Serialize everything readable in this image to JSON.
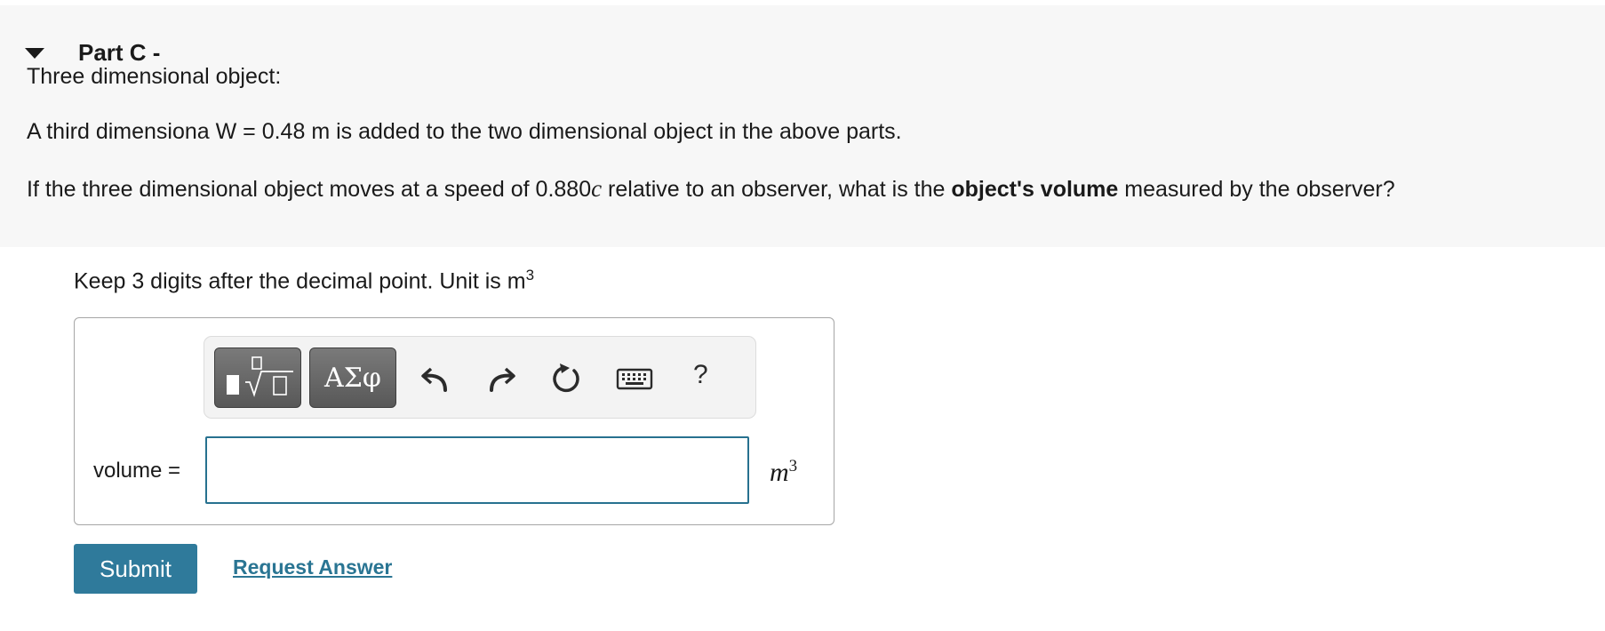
{
  "part": {
    "title": "Part C -"
  },
  "question": {
    "subtitle": "Three dimensional object:",
    "line1": "A third dimensiona W = 0.48 m is added to the two dimensional object in the above parts.",
    "line2_before_speed": "If the three dimensional object moves at a speed of 0.880",
    "line2_c": "c",
    "line2_mid": " relative to an observer, what is the ",
    "line2_bold": "object's volume",
    "line2_after": " measured by the observer?"
  },
  "instructions": {
    "text": "Keep 3 digits after the decimal point. Unit is m",
    "unit_exp": "3"
  },
  "toolbar": {
    "templates_icon": "fraction-sqrt-templates-icon",
    "symbols_label": "ΑΣφ",
    "undo_icon": "undo-icon",
    "redo_icon": "redo-icon",
    "reset_icon": "reset-icon",
    "keyboard_icon": "keyboard-icon",
    "help_label": "?"
  },
  "answer": {
    "label": "volume =",
    "value": "",
    "unit": "m",
    "unit_exp": "3"
  },
  "actions": {
    "submit_label": "Submit",
    "request_label": "Request Answer"
  },
  "colors": {
    "accent": "#2f7a9b",
    "link": "#2a7593",
    "panel_bg": "#f7f7f7"
  }
}
